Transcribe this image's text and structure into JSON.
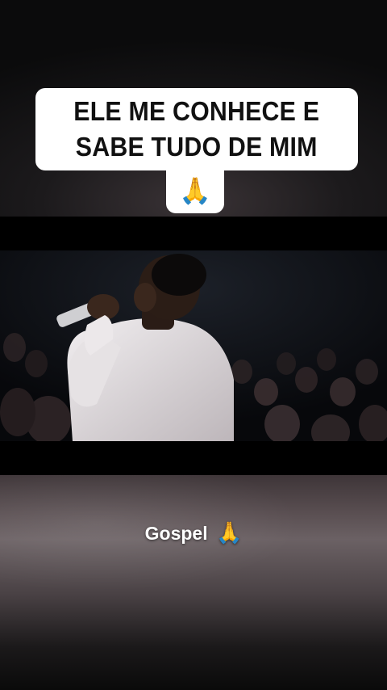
{
  "overlay_caption": {
    "text": "ELE ME CONHECE E\nSABE TUDO DE MIM",
    "emoji": "🙏"
  },
  "video": {
    "scene": "singer-on-stage",
    "colors": {
      "suit": "#e8e4e6",
      "backdrop": "#0d0f14",
      "crowd": "#2a2224"
    }
  },
  "footer_caption": {
    "text": "Gospel",
    "emoji": "🙏"
  }
}
